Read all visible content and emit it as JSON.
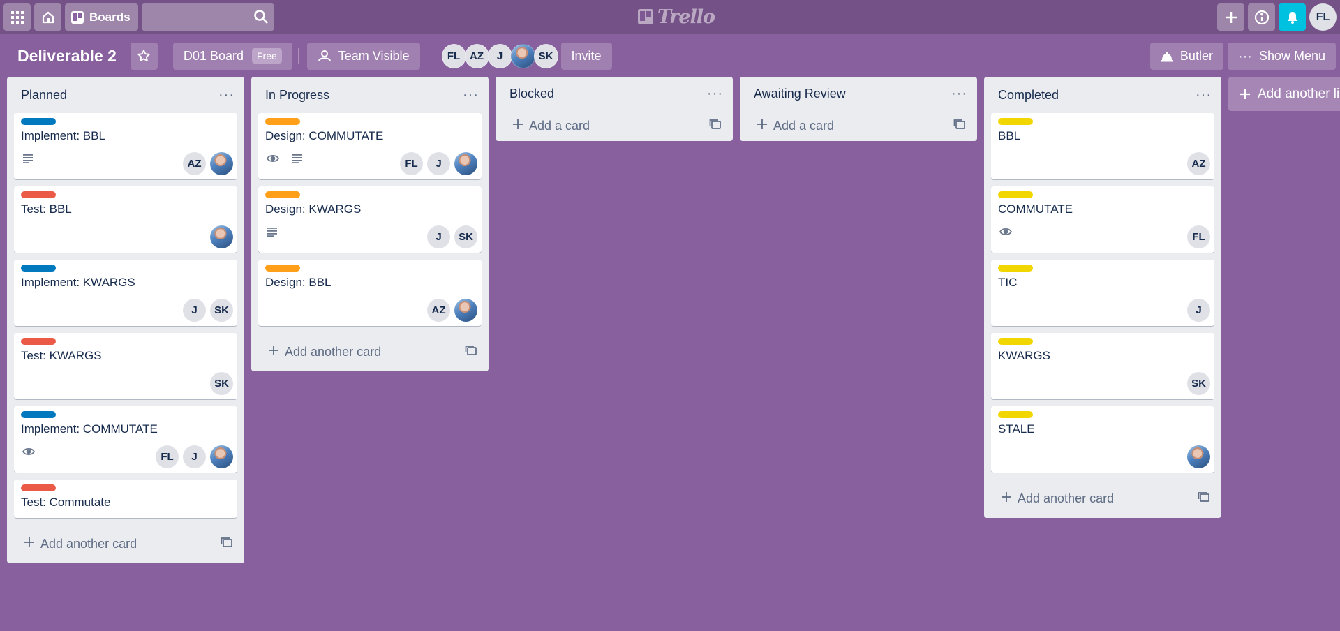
{
  "header": {
    "boards_label": "Boards",
    "search_value": "",
    "logo_text": "Trello",
    "user_initials": "FL"
  },
  "board": {
    "title": "Deliverable 2",
    "board_name": "D01 Board",
    "plan_badge": "Free",
    "visibility": "Team Visible",
    "members": [
      "FL",
      "AZ",
      "J",
      "",
      "SK"
    ],
    "invite_label": "Invite",
    "butler_label": "Butler",
    "menu_label": "Show Menu"
  },
  "colors": {
    "background": "#89609e",
    "blue": "#0079bf",
    "red": "#eb5a46",
    "orange": "#ff9f1a",
    "yellow": "#f2d600",
    "notify": "#00c2e0"
  },
  "lists": [
    {
      "title": "Planned",
      "add_label": "Add another card",
      "cards": [
        {
          "title": "Implement: BBL",
          "label_color": "#0079bf",
          "desc": true,
          "watch": false,
          "members": [
            "AZ",
            "photo"
          ]
        },
        {
          "title": "Test: BBL",
          "label_color": "#eb5a46",
          "desc": false,
          "watch": false,
          "members": [
            "photo"
          ]
        },
        {
          "title": "Implement: KWARGS",
          "label_color": "#0079bf",
          "desc": false,
          "watch": false,
          "members": [
            "J",
            "SK"
          ]
        },
        {
          "title": "Test: KWARGS",
          "label_color": "#eb5a46",
          "desc": false,
          "watch": false,
          "members": [
            "SK"
          ]
        },
        {
          "title": "Implement: COMMUTATE",
          "label_color": "#0079bf",
          "desc": false,
          "watch": true,
          "members": [
            "FL",
            "J",
            "photo"
          ]
        },
        {
          "title": "Test: Commutate",
          "label_color": "#eb5a46",
          "desc": false,
          "watch": false,
          "members": []
        }
      ]
    },
    {
      "title": "In Progress",
      "add_label": "Add another card",
      "cards": [
        {
          "title": "Design: COMMUTATE",
          "label_color": "#ff9f1a",
          "desc": true,
          "watch": true,
          "members": [
            "FL",
            "J",
            "photo"
          ]
        },
        {
          "title": "Design: KWARGS",
          "label_color": "#ff9f1a",
          "desc": true,
          "watch": false,
          "members": [
            "J",
            "SK"
          ]
        },
        {
          "title": "Design: BBL",
          "label_color": "#ff9f1a",
          "desc": false,
          "watch": false,
          "members": [
            "AZ",
            "photo"
          ]
        }
      ]
    },
    {
      "title": "Blocked",
      "add_label": "Add a card",
      "cards": []
    },
    {
      "title": "Awaiting Review",
      "add_label": "Add a card",
      "cards": []
    },
    {
      "title": "Completed",
      "add_label": "Add another card",
      "cards": [
        {
          "title": "BBL",
          "label_color": "#f2d600",
          "desc": false,
          "watch": false,
          "members": [
            "AZ"
          ]
        },
        {
          "title": "COMMUTATE",
          "label_color": "#f2d600",
          "desc": false,
          "watch": true,
          "members": [
            "FL"
          ]
        },
        {
          "title": "TIC",
          "label_color": "#f2d600",
          "desc": false,
          "watch": false,
          "members": [
            "J"
          ]
        },
        {
          "title": "KWARGS",
          "label_color": "#f2d600",
          "desc": false,
          "watch": false,
          "members": [
            "SK"
          ]
        },
        {
          "title": "STALE",
          "label_color": "#f2d600",
          "desc": false,
          "watch": false,
          "members": [
            "photo"
          ]
        }
      ]
    }
  ],
  "add_list_label": "Add another list"
}
